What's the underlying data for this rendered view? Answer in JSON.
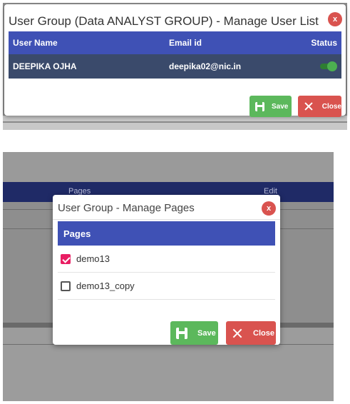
{
  "manage_users": {
    "title": "User Group (Data ANALYST GROUP) - Manage User List",
    "close_label": "x",
    "columns": [
      "User Name",
      "Email id",
      "Status"
    ],
    "rows": [
      {
        "user_name": "DEEPIKA OJHA",
        "email": "deepika02@nic.in",
        "status": "active"
      }
    ],
    "save_label": "Save",
    "close_button_label": "Close"
  },
  "background_table": {
    "columns": [
      "Pages",
      "Edit"
    ]
  },
  "manage_pages": {
    "title": "User Group - Manage Pages",
    "close_label": "x",
    "header": "Pages",
    "items": [
      {
        "label": "demo13",
        "checked": true
      },
      {
        "label": "demo13_copy",
        "checked": false
      }
    ],
    "save_label": "Save",
    "close_button_label": "Close"
  },
  "colors": {
    "primary": "#3f51b5",
    "row_dark": "#3a4a6b",
    "save": "#5cb85c",
    "danger": "#d9534f",
    "checkbox": "#e91e63",
    "toggle_on": "#4caf50"
  },
  "icons": {
    "save": "floppy-disk-icon",
    "close": "x-icon",
    "dialog_close": "close-circle-icon",
    "check": "checkbox-checked-icon"
  }
}
